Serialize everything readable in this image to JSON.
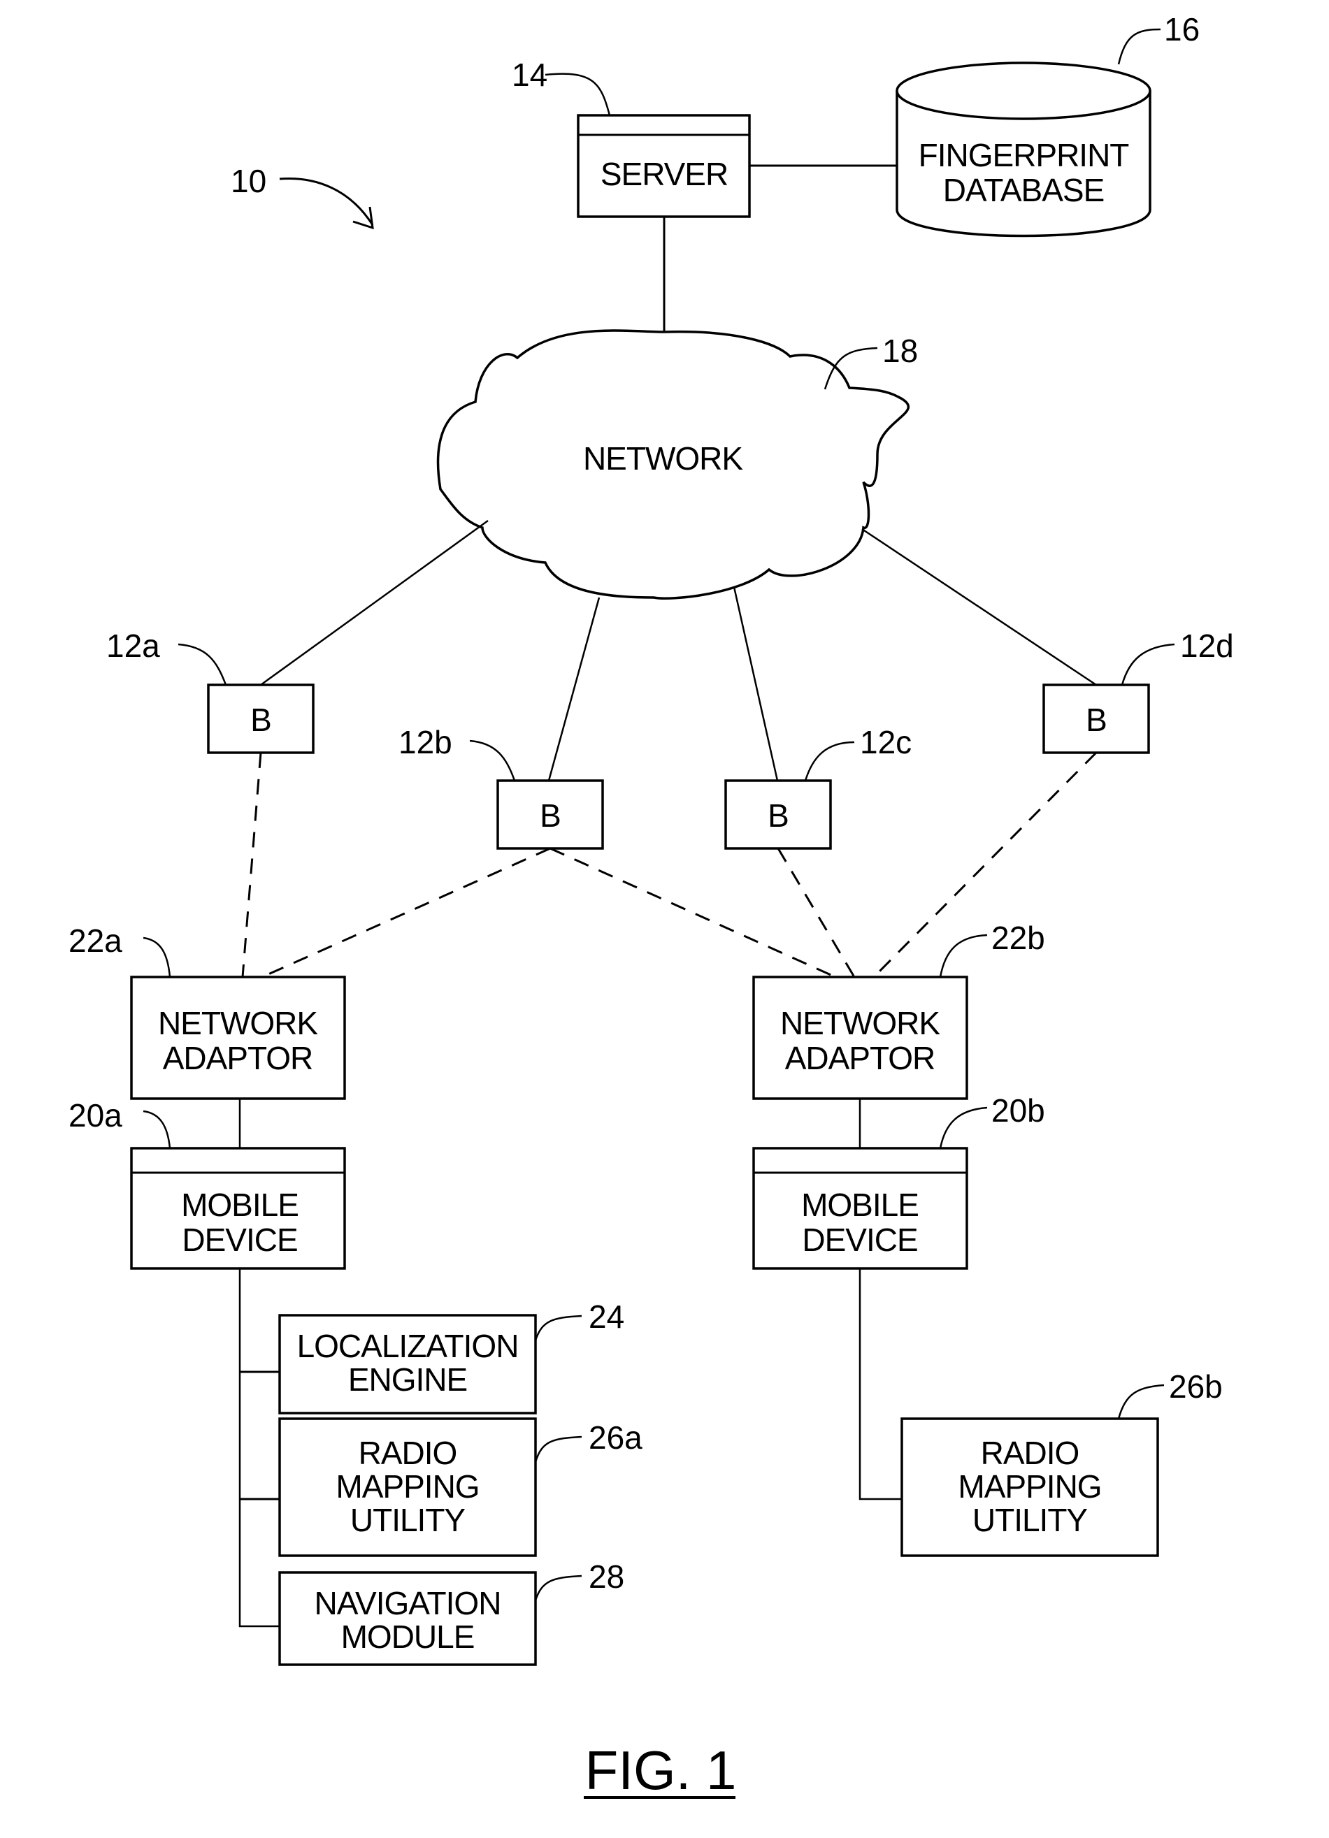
{
  "figure": {
    "caption": "FIG. 1",
    "system_ref": "10"
  },
  "server": {
    "label": "SERVER",
    "ref": "14"
  },
  "database": {
    "lines": [
      "FINGERPRINT",
      "DATABASE"
    ],
    "ref": "16"
  },
  "network": {
    "label": "NETWORK",
    "ref": "18"
  },
  "beacons": [
    {
      "label": "B",
      "ref": "12a"
    },
    {
      "label": "B",
      "ref": "12b"
    },
    {
      "label": "B",
      "ref": "12c"
    },
    {
      "label": "B",
      "ref": "12d"
    }
  ],
  "network_adaptors": [
    {
      "lines": [
        "NETWORK",
        "ADAPTOR"
      ],
      "ref": "22a"
    },
    {
      "lines": [
        "NETWORK",
        "ADAPTOR"
      ],
      "ref": "22b"
    }
  ],
  "mobile_devices": [
    {
      "lines": [
        "MOBILE",
        "DEVICE"
      ],
      "ref": "20a"
    },
    {
      "lines": [
        "MOBILE",
        "DEVICE"
      ],
      "ref": "20b"
    }
  ],
  "modules_a": [
    {
      "lines": [
        "LOCALIZATION",
        "ENGINE"
      ],
      "ref": "24"
    },
    {
      "lines": [
        "RADIO",
        "MAPPING",
        "UTILITY"
      ],
      "ref": "26a"
    },
    {
      "lines": [
        "NAVIGATION",
        "MODULE"
      ],
      "ref": "28"
    }
  ],
  "modules_b": [
    {
      "lines": [
        "RADIO",
        "MAPPING",
        "UTILITY"
      ],
      "ref": "26b"
    }
  ]
}
